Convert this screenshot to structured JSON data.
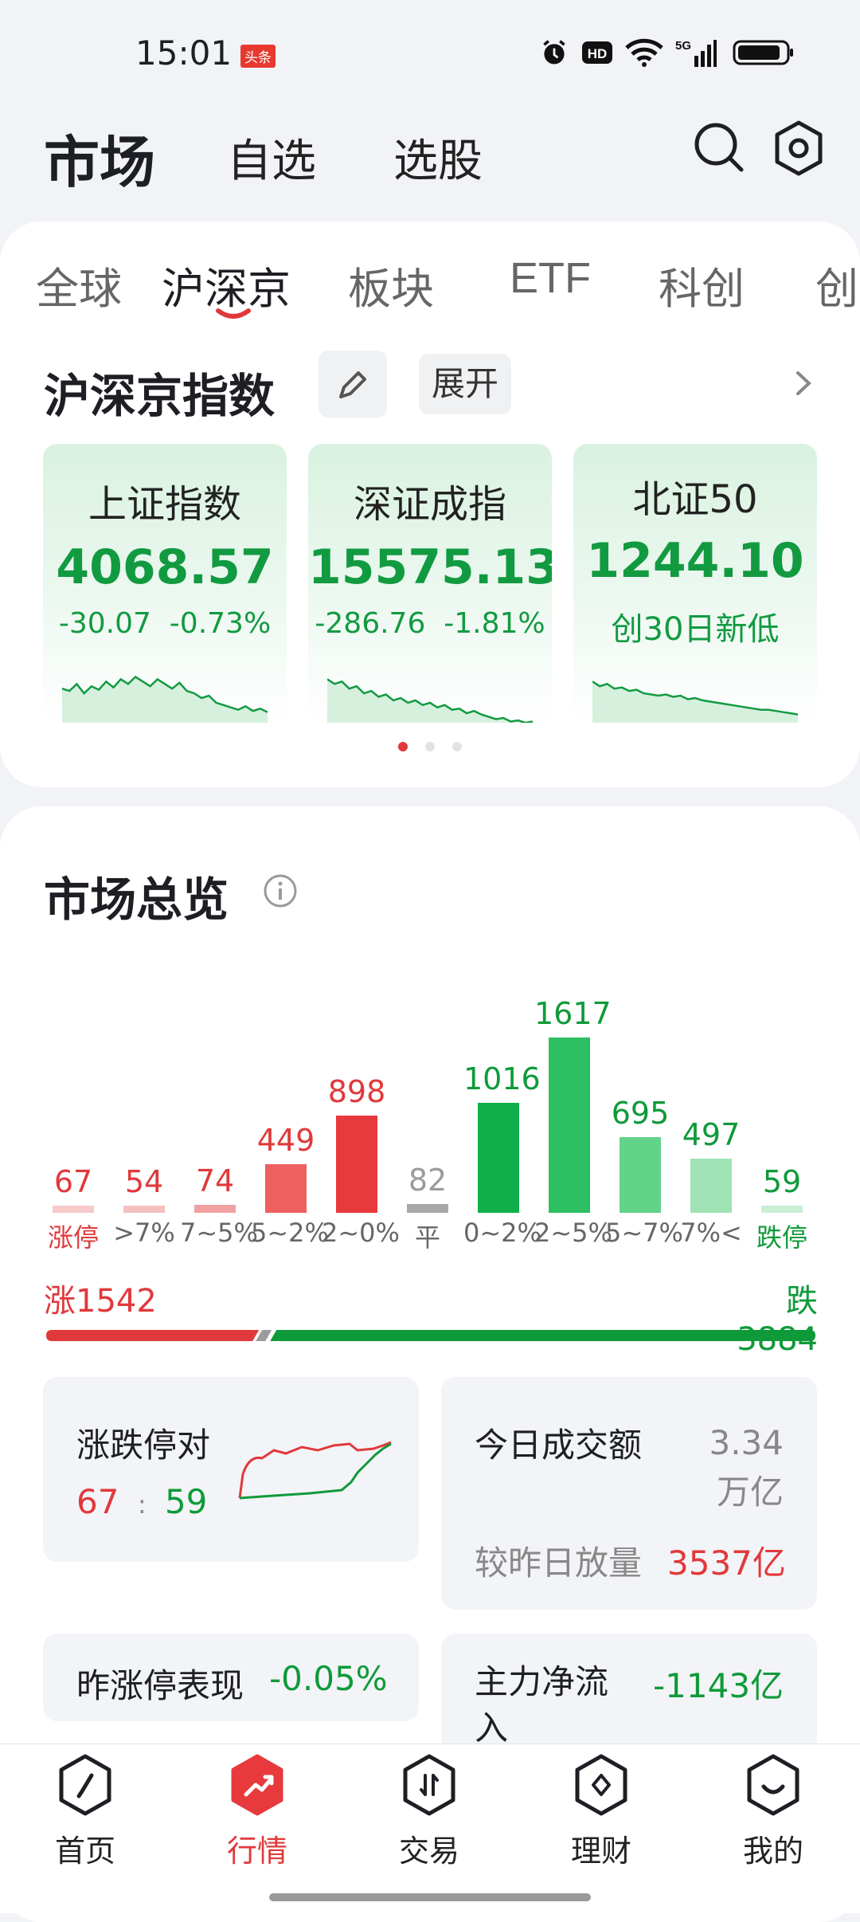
{
  "status_bar": {
    "time": "15:01",
    "news_badge": "头条",
    "icons": [
      "alarm-icon",
      "hd-icon",
      "wifi-icon",
      "5g-signal-icon",
      "battery-icon"
    ]
  },
  "header": {
    "title": "市场",
    "tabs": [
      "自选",
      "选股"
    ],
    "icons": [
      "search-icon",
      "settings-icon"
    ]
  },
  "category_tabs": {
    "items": [
      "全球",
      "沪深京",
      "板块",
      "ETF",
      "科创",
      "创"
    ],
    "active": "沪深京"
  },
  "indices_section": {
    "title": "沪深京指数",
    "expand_label": "展开",
    "cards": [
      {
        "name": "上证指数",
        "value": "4068.57",
        "change": "-30.07",
        "change_pct": "-0.73%",
        "sparkline": [
          62,
          60,
          66,
          58,
          64,
          61,
          68,
          63,
          70,
          66,
          72,
          68,
          64,
          70,
          66,
          62,
          67,
          60,
          58,
          54,
          56,
          50,
          48,
          46,
          44,
          47,
          43,
          45,
          42
        ]
      },
      {
        "name": "深证成指",
        "value": "15575.13",
        "change": "-286.76",
        "change_pct": "-1.81%",
        "sparkline": [
          70,
          66,
          68,
          62,
          64,
          58,
          60,
          55,
          57,
          52,
          54,
          50,
          52,
          48,
          50,
          46,
          48,
          44,
          45,
          41,
          43,
          40,
          38,
          36,
          37,
          34,
          35,
          33,
          34
        ]
      },
      {
        "name": "北证50",
        "value": "1244.10",
        "note": "创30日新低",
        "sparkline": [
          68,
          64,
          66,
          62,
          63,
          60,
          61,
          58,
          57,
          56,
          57,
          55,
          56,
          53,
          54,
          52,
          51,
          50,
          49,
          48,
          47,
          46,
          45,
          44,
          44,
          43,
          42,
          41,
          40
        ]
      }
    ],
    "page_dots": 3,
    "active_dot": 0
  },
  "overview": {
    "title": "市场总览",
    "colors": {
      "up": "#e0393b",
      "down": "#0f9a3a",
      "flat": "#9b9b9b"
    },
    "distribution": [
      {
        "label": "涨停",
        "count": 67,
        "color": "#f7c9c9",
        "text_color": "#e0393b"
      },
      {
        "label": ">7%",
        "count": 54,
        "color": "#f5c0c0",
        "text_color": "#e0393b"
      },
      {
        "label": "7~5%",
        "count": 74,
        "color": "#f1a1a1",
        "text_color": "#e0393b"
      },
      {
        "label": "5~2%",
        "count": 449,
        "color": "#ee6060",
        "text_color": "#e0393b"
      },
      {
        "label": "2~0%",
        "count": 898,
        "color": "#e8393d",
        "text_color": "#e0393b"
      },
      {
        "label": "平",
        "count": 82,
        "color": "#a8a8a8",
        "text_color": "#9b9b9b"
      },
      {
        "label": "0~2%",
        "count": 1016,
        "color": "#0fb04a",
        "text_color": "#0f9a3a"
      },
      {
        "label": "2~5%",
        "count": 1617,
        "color": "#2cc063",
        "text_color": "#0f9a3a"
      },
      {
        "label": "5~7%",
        "count": 695,
        "color": "#62d48a",
        "text_color": "#0f9a3a"
      },
      {
        "label": "7%<",
        "count": 497,
        "color": "#9fe3b5",
        "text_color": "#0f9a3a"
      },
      {
        "label": "跌停",
        "count": 59,
        "color": "#c9efd5",
        "text_color": "#0f9a3a"
      }
    ],
    "rise_label": "涨1542",
    "fall_label": "跌3884",
    "rise_count": 1542,
    "fall_count": 3884,
    "limit_card": {
      "title": "涨跌停对",
      "up": "67",
      "sep": ":",
      "down": "59"
    },
    "turnover_card": {
      "title": "今日成交额",
      "value": "3.34万亿",
      "compare_label": "较昨日放量",
      "compare_value": "3537亿"
    },
    "yesterday_card": {
      "title": "昨涨停表现",
      "value": "-0.05%"
    },
    "flow_card": {
      "title": "主力净流入",
      "value": "-1143亿"
    }
  },
  "bottom_nav": {
    "items": [
      {
        "label": "首页",
        "icon": "compass-icon"
      },
      {
        "label": "行情",
        "icon": "market-trend-icon"
      },
      {
        "label": "交易",
        "icon": "trade-icon"
      },
      {
        "label": "理财",
        "icon": "wealth-icon"
      },
      {
        "label": "我的",
        "icon": "profile-icon"
      }
    ],
    "active": "行情"
  }
}
